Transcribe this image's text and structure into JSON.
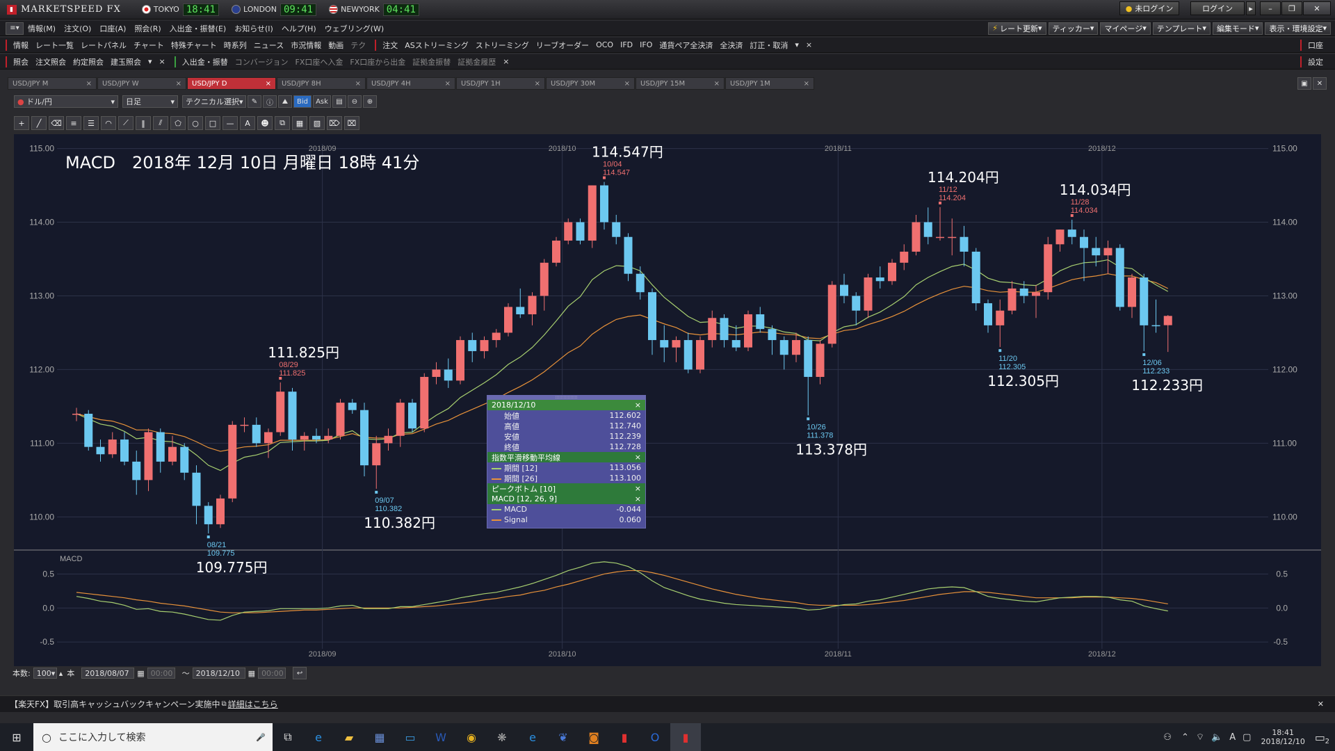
{
  "app": {
    "name": "MARKETSPEED FX",
    "clocks": [
      {
        "city": "TOKYO",
        "time": "18:41"
      },
      {
        "city": "LONDON",
        "time": "09:41"
      },
      {
        "city": "NEWYORK",
        "time": "04:41"
      }
    ],
    "login_status": "未ログイン",
    "login_button": "ログイン"
  },
  "menu": {
    "items": [
      "情報(M)",
      "注文(O)",
      "口座(A)",
      "照会(R)",
      "入出金・振替(E)",
      "お知らせ(I)",
      "ヘルプ(H)",
      "ウェブリング(W)"
    ],
    "right_buttons": [
      "レート更新",
      "ティッカー",
      "マイページ",
      "テンプレート",
      "編集モード",
      "表示・環境設定"
    ]
  },
  "toolbar1": {
    "info_label": "情報",
    "info_items": [
      "レート一覧",
      "レートパネル",
      "チャート",
      "特殊チャート",
      "時系列",
      "ニュース",
      "市況情報",
      "動画",
      "テク"
    ],
    "order_label": "注文",
    "order_items": [
      "ASストリーミング",
      "ストリーミング",
      "リーブオーダー",
      "OCO",
      "IFD",
      "IFO",
      "通貨ペア全決済",
      "全決済",
      "訂正・取消"
    ],
    "right_label": "口座"
  },
  "toolbar2": {
    "query_label": "照会",
    "query_items": [
      "注文照会",
      "約定照会",
      "建玉照会"
    ],
    "transfer_label": "入出金・振替",
    "transfer_items": [
      "コンバージョン",
      "FX口座へ入金",
      "FX口座から出金",
      "証拠金振替",
      "証拠金履歴"
    ],
    "right_label": "設定"
  },
  "tabs": [
    "USD/JPY M",
    "USD/JPY W",
    "USD/JPY D",
    "USD/JPY 8H",
    "USD/JPY 4H",
    "USD/JPY 1H",
    "USD/JPY 30M",
    "USD/JPY 15M",
    "USD/JPY 1M"
  ],
  "active_tab": "USD/JPY D",
  "controls": {
    "currency": "ドル/円",
    "period": "日足",
    "technical": "テクニカル選択",
    "bid": "Bid",
    "ask": "Ask"
  },
  "chart_data": {
    "type": "candlestick",
    "title": "MACD　2018年 12月 10日 月曜日 18時 41分",
    "months": [
      {
        "label": "2018/09",
        "index": 21
      },
      {
        "label": "2018/10",
        "index": 41
      },
      {
        "label": "2018/11",
        "index": 64
      },
      {
        "label": "2018/12",
        "index": 86
      }
    ],
    "ylim": [
      109.55,
      115.1
    ],
    "yticks": [
      "115.00",
      "114.00",
      "113.00",
      "112.00",
      "111.00",
      "110.00"
    ],
    "candles": [
      [
        111.4,
        111.48,
        111.3,
        111.4
      ],
      [
        111.4,
        111.45,
        110.9,
        110.95
      ],
      [
        110.95,
        111.05,
        110.75,
        110.85
      ],
      [
        110.85,
        111.15,
        110.8,
        111.05
      ],
      [
        111.05,
        111.15,
        110.7,
        110.75
      ],
      [
        110.75,
        110.9,
        110.3,
        110.5
      ],
      [
        110.5,
        111.2,
        110.35,
        111.15
      ],
      [
        111.15,
        111.2,
        110.6,
        110.75
      ],
      [
        110.75,
        111.1,
        110.7,
        110.95
      ],
      [
        110.95,
        111.0,
        110.5,
        110.6
      ],
      [
        110.6,
        110.7,
        109.9,
        110.15
      ],
      [
        110.15,
        110.2,
        109.775,
        109.9
      ],
      [
        109.9,
        110.3,
        109.85,
        110.25
      ],
      [
        110.25,
        111.3,
        110.2,
        111.25
      ],
      [
        111.25,
        111.35,
        111.15,
        111.25
      ],
      [
        111.25,
        111.35,
        110.95,
        111.0
      ],
      [
        111.0,
        111.2,
        110.8,
        111.15
      ],
      [
        111.15,
        111.825,
        111.1,
        111.7
      ],
      [
        111.7,
        111.75,
        110.9,
        111.05
      ],
      [
        111.05,
        111.15,
        110.9,
        111.1
      ],
      [
        111.1,
        111.2,
        111.0,
        111.05
      ],
      [
        111.05,
        111.2,
        111.0,
        111.1
      ],
      [
        111.1,
        111.6,
        111.05,
        111.55
      ],
      [
        111.55,
        111.6,
        111.4,
        111.45
      ],
      [
        111.45,
        111.55,
        110.55,
        110.7
      ],
      [
        110.7,
        111.1,
        110.382,
        111.0
      ],
      [
        111.0,
        111.2,
        110.9,
        111.1
      ],
      [
        111.1,
        111.6,
        110.95,
        111.55
      ],
      [
        111.55,
        111.6,
        111.15,
        111.2
      ],
      [
        111.2,
        111.95,
        111.15,
        111.9
      ],
      [
        111.9,
        112.1,
        111.8,
        112.0
      ],
      [
        112.0,
        112.15,
        111.75,
        111.85
      ],
      [
        111.85,
        112.45,
        111.8,
        112.4
      ],
      [
        112.4,
        112.5,
        112.1,
        112.25
      ],
      [
        112.25,
        112.45,
        112.15,
        112.4
      ],
      [
        112.4,
        112.55,
        112.3,
        112.5
      ],
      [
        112.5,
        112.9,
        112.45,
        112.85
      ],
      [
        112.85,
        113.1,
        112.7,
        112.75
      ],
      [
        112.75,
        113.05,
        112.6,
        113.0
      ],
      [
        113.0,
        113.5,
        112.8,
        113.45
      ],
      [
        113.45,
        113.8,
        113.4,
        113.75
      ],
      [
        113.75,
        114.05,
        113.7,
        114.0
      ],
      [
        114.0,
        114.05,
        113.7,
        113.75
      ],
      [
        113.75,
        114.5,
        113.65,
        114.5
      ],
      [
        114.5,
        114.547,
        113.9,
        114.0
      ],
      [
        114.0,
        114.1,
        113.7,
        113.8
      ],
      [
        113.8,
        113.85,
        113.2,
        113.3
      ],
      [
        113.3,
        113.4,
        112.95,
        113.05
      ],
      [
        113.05,
        113.1,
        112.2,
        112.4
      ],
      [
        112.4,
        112.6,
        112.1,
        112.3
      ],
      [
        112.3,
        112.45,
        112.1,
        112.4
      ],
      [
        112.4,
        112.5,
        111.95,
        112.0
      ],
      [
        112.0,
        112.45,
        111.95,
        112.4
      ],
      [
        112.4,
        112.8,
        112.3,
        112.7
      ],
      [
        112.7,
        112.75,
        112.3,
        112.4
      ],
      [
        112.4,
        112.6,
        112.25,
        112.3
      ],
      [
        112.3,
        112.8,
        112.25,
        112.75
      ],
      [
        112.75,
        112.85,
        112.5,
        112.55
      ],
      [
        112.55,
        112.6,
        112.2,
        112.4
      ],
      [
        112.4,
        112.45,
        112.0,
        112.2
      ],
      [
        112.2,
        112.5,
        112.1,
        112.4
      ],
      [
        112.4,
        112.45,
        111.378,
        111.9
      ],
      [
        111.9,
        112.4,
        111.8,
        112.35
      ],
      [
        112.35,
        113.2,
        112.3,
        113.15
      ],
      [
        113.15,
        113.3,
        112.9,
        113.0
      ],
      [
        113.0,
        113.05,
        112.6,
        112.8
      ],
      [
        112.8,
        113.3,
        112.7,
        113.25
      ],
      [
        113.25,
        113.4,
        113.1,
        113.2
      ],
      [
        113.2,
        113.5,
        113.15,
        113.45
      ],
      [
        113.45,
        113.7,
        113.35,
        113.6
      ],
      [
        113.6,
        114.1,
        113.55,
        114.0
      ],
      [
        114.0,
        114.2,
        113.7,
        113.8
      ],
      [
        113.8,
        114.204,
        113.75,
        113.8
      ],
      [
        113.8,
        114.05,
        113.55,
        113.8
      ],
      [
        113.8,
        113.95,
        113.4,
        113.6
      ],
      [
        113.6,
        113.65,
        112.8,
        112.9
      ],
      [
        112.9,
        112.95,
        112.5,
        112.6
      ],
      [
        112.6,
        112.95,
        112.305,
        112.8
      ],
      [
        112.8,
        113.2,
        112.75,
        113.1
      ],
      [
        113.1,
        113.2,
        112.9,
        113.0
      ],
      [
        113.0,
        113.15,
        112.7,
        113.05
      ],
      [
        113.05,
        113.8,
        112.95,
        113.7
      ],
      [
        113.7,
        113.9,
        113.6,
        113.9
      ],
      [
        113.9,
        114.034,
        113.7,
        113.8
      ],
      [
        113.8,
        113.9,
        113.2,
        113.65
      ],
      [
        113.65,
        113.8,
        113.4,
        113.55
      ],
      [
        113.55,
        113.75,
        113.3,
        113.65
      ],
      [
        113.65,
        113.7,
        112.8,
        112.85
      ],
      [
        112.85,
        113.3,
        112.7,
        113.25
      ],
      [
        113.25,
        113.3,
        112.25,
        112.6
      ],
      [
        112.602,
        112.95,
        112.5,
        112.6
      ],
      [
        112.602,
        112.74,
        112.239,
        112.728
      ]
    ],
    "ema12": [
      111.4,
      111.33,
      111.26,
      111.23,
      111.16,
      111.06,
      111.08,
      111.03,
      111.02,
      110.96,
      110.84,
      110.7,
      110.63,
      110.73,
      110.81,
      110.84,
      110.89,
      111.01,
      111.02,
      111.03,
      111.03,
      111.04,
      111.12,
      111.17,
      111.06,
      111.05,
      111.06,
      111.14,
      111.15,
      111.27,
      111.38,
      111.47,
      111.62,
      111.72,
      111.82,
      111.93,
      112.07,
      112.17,
      112.3,
      112.47,
      112.66,
      112.86,
      112.99,
      113.22,
      113.34,
      113.41,
      113.4,
      113.34,
      113.15,
      112.98,
      112.85,
      112.72,
      112.64,
      112.65,
      112.61,
      112.56,
      112.59,
      112.59,
      112.56,
      112.51,
      112.49,
      112.4,
      112.39,
      112.5,
      112.58,
      112.61,
      112.71,
      112.78,
      112.88,
      112.99,
      113.15,
      113.25,
      113.33,
      113.4,
      113.43,
      113.35,
      113.24,
      113.19,
      113.18,
      113.15,
      113.14,
      113.23,
      113.34,
      113.41,
      113.45,
      113.46,
      113.49,
      113.39,
      113.37,
      113.25,
      113.15,
      113.06
    ],
    "ema26": [
      111.4,
      111.36,
      111.32,
      111.3,
      111.25,
      111.18,
      111.18,
      111.14,
      111.13,
      111.09,
      111.02,
      110.94,
      110.89,
      110.92,
      110.95,
      110.96,
      110.98,
      111.04,
      111.04,
      111.04,
      111.04,
      111.05,
      111.09,
      111.13,
      111.08,
      111.07,
      111.07,
      111.12,
      111.13,
      111.19,
      111.26,
      111.31,
      111.39,
      111.46,
      111.53,
      111.6,
      111.69,
      111.77,
      111.86,
      111.97,
      112.1,
      112.23,
      112.32,
      112.48,
      112.59,
      112.68,
      112.72,
      112.74,
      112.68,
      112.62,
      112.57,
      112.49,
      112.47,
      112.49,
      112.48,
      112.47,
      112.49,
      112.51,
      112.5,
      112.48,
      112.47,
      112.43,
      112.42,
      112.48,
      112.53,
      112.55,
      112.61,
      112.66,
      112.72,
      112.79,
      112.88,
      112.96,
      113.03,
      113.09,
      113.13,
      113.11,
      113.07,
      113.05,
      113.06,
      113.05,
      113.05,
      113.1,
      113.16,
      113.22,
      113.25,
      113.27,
      113.3,
      113.27,
      113.27,
      113.22,
      113.18,
      113.1
    ],
    "macd": [
      0.17,
      0.14,
      0.1,
      0.08,
      0.04,
      -0.02,
      -0.01,
      -0.05,
      -0.06,
      -0.09,
      -0.13,
      -0.17,
      -0.18,
      -0.11,
      -0.06,
      -0.05,
      -0.04,
      -0.01,
      -0.01,
      -0.01,
      -0.01,
      0.0,
      0.03,
      0.04,
      -0.01,
      -0.01,
      -0.01,
      0.02,
      0.02,
      0.05,
      0.08,
      0.11,
      0.15,
      0.18,
      0.21,
      0.23,
      0.27,
      0.31,
      0.36,
      0.42,
      0.48,
      0.55,
      0.6,
      0.66,
      0.68,
      0.66,
      0.61,
      0.52,
      0.4,
      0.3,
      0.24,
      0.18,
      0.13,
      0.1,
      0.07,
      0.05,
      0.04,
      0.03,
      0.02,
      0.01,
      0.0,
      -0.03,
      -0.02,
      0.02,
      0.05,
      0.06,
      0.1,
      0.12,
      0.16,
      0.2,
      0.24,
      0.28,
      0.3,
      0.31,
      0.3,
      0.24,
      0.17,
      0.14,
      0.12,
      0.1,
      0.09,
      0.12,
      0.15,
      0.16,
      0.17,
      0.17,
      0.16,
      0.12,
      0.1,
      0.03,
      -0.01,
      -0.044
    ],
    "signal": [
      0.23,
      0.21,
      0.19,
      0.17,
      0.15,
      0.12,
      0.1,
      0.07,
      0.05,
      0.03,
      0.0,
      -0.03,
      -0.06,
      -0.07,
      -0.07,
      -0.07,
      -0.06,
      -0.05,
      -0.04,
      -0.03,
      -0.03,
      -0.02,
      -0.01,
      0.0,
      0.0,
      0.0,
      0.0,
      0.0,
      0.01,
      0.02,
      0.03,
      0.05,
      0.07,
      0.09,
      0.12,
      0.14,
      0.17,
      0.19,
      0.23,
      0.26,
      0.31,
      0.35,
      0.4,
      0.45,
      0.5,
      0.53,
      0.55,
      0.55,
      0.52,
      0.48,
      0.43,
      0.38,
      0.33,
      0.28,
      0.24,
      0.2,
      0.17,
      0.14,
      0.12,
      0.1,
      0.08,
      0.05,
      0.04,
      0.04,
      0.04,
      0.04,
      0.05,
      0.07,
      0.09,
      0.11,
      0.14,
      0.17,
      0.2,
      0.22,
      0.24,
      0.24,
      0.23,
      0.21,
      0.19,
      0.17,
      0.15,
      0.15,
      0.15,
      0.15,
      0.16,
      0.16,
      0.16,
      0.15,
      0.14,
      0.12,
      0.09,
      0.06
    ],
    "macd_ylim": [
      -0.6,
      0.75
    ],
    "macd_ticks": [
      "0.5",
      "0.0",
      "-0.5"
    ],
    "peaks": [
      {
        "index": 11,
        "date": "08/21",
        "value": "109.775",
        "big": "109.775円",
        "kind": "low"
      },
      {
        "index": 17,
        "date": "08/29",
        "value": "111.825",
        "big": "111.825円",
        "kind": "high"
      },
      {
        "index": 25,
        "date": "09/07",
        "value": "110.382",
        "big": "110.382円",
        "kind": "low"
      },
      {
        "index": 44,
        "date": "10/04",
        "value": "114.547",
        "big": "114.547円",
        "kind": "high"
      },
      {
        "index": 61,
        "date": "10/26",
        "value": "111.378",
        "big": "113.378円",
        "kind": "low"
      },
      {
        "index": 72,
        "date": "11/12",
        "value": "114.204",
        "big": "114.204円",
        "kind": "high"
      },
      {
        "index": 77,
        "date": "11/20",
        "value": "112.305",
        "big": "112.305円",
        "kind": "low"
      },
      {
        "index": 83,
        "date": "11/28",
        "value": "114.034",
        "big": "114.034円",
        "kind": "high"
      },
      {
        "index": 89,
        "date": "12/06",
        "value": "112.233",
        "big": "112.233円",
        "kind": "low"
      }
    ],
    "macd_label": "MACD",
    "colors": {
      "up": "#f07070",
      "down": "#6cc8f0",
      "ema12": "#a8d070",
      "ema26": "#e8923a",
      "macd": "#a8d070",
      "signal": "#e8923a",
      "bg": "#15192a"
    }
  },
  "popup": {
    "date": "2018/12/10",
    "ohlc": [
      {
        "label": "始値",
        "value": "112.602"
      },
      {
        "label": "高値",
        "value": "112.740"
      },
      {
        "label": "安値",
        "value": "112.239"
      },
      {
        "label": "終値",
        "value": "112.728"
      }
    ],
    "ema_title": "指数平滑移動平均線",
    "ema": [
      {
        "label": "期間 [12]",
        "value": "113.056"
      },
      {
        "label": "期間 [26]",
        "value": "113.100"
      }
    ],
    "peak_title": "ピークボトム [10]",
    "macd_title": "MACD [12, 26, 9]",
    "macd": [
      {
        "label": "MACD",
        "value": "-0.044"
      },
      {
        "label": "Signal",
        "value": "0.060"
      }
    ]
  },
  "bottom": {
    "count_label": "本数:",
    "count_value": "100",
    "count_unit": "本",
    "from_date": "2018/08/07",
    "from_time": "00:00",
    "tilde": "〜",
    "to_date": "2018/12/10",
    "to_time": "00:00"
  },
  "news": {
    "text": "【楽天FX】取引高キャッシュバックキャンペーン実施中",
    "link": "詳細はこちら"
  },
  "taskbar": {
    "search_placeholder": "ここに入力して検索",
    "time": "18:41",
    "date": "2018/12/10",
    "ime": "A",
    "notif_count": "2"
  }
}
